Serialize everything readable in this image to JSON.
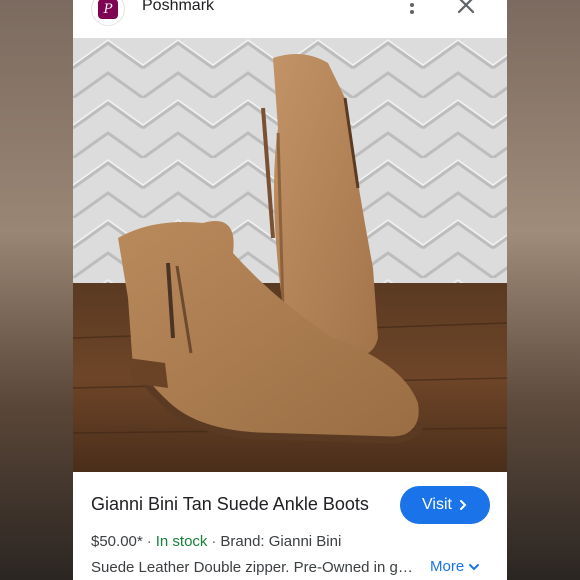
{
  "header": {
    "site_name": "Poshmark",
    "site_icon": "poshmark-logo",
    "menu_icon": "more-vert-icon",
    "close_icon": "close-icon"
  },
  "image": {
    "description_icon": "product-photo"
  },
  "product": {
    "title": "Gianni Bini Tan Suede Ankle Boots",
    "price": "$50.00*",
    "stock": "In stock",
    "brand": "Brand: Gianni Bini",
    "description": "Suede Leather Double zipper. Pre-Owned in good condition",
    "visit_label": "Visit",
    "more_label": "More"
  },
  "colors": {
    "accent": "#1a73e8",
    "in_stock": "#188038",
    "brand": "#7f0353"
  }
}
